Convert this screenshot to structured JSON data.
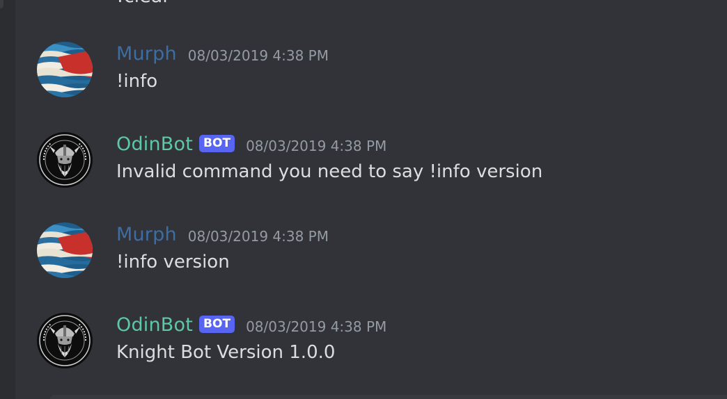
{
  "previous_message": {
    "text": "!clear"
  },
  "colors": {
    "background": "#313338",
    "murph_name": "#3c6ea5",
    "odinbot_name": "#5ec8a6",
    "bot_tag": "#5865f2",
    "timestamp": "#949ba4",
    "text": "#dbdee1"
  },
  "messages": [
    {
      "author": "Murph",
      "is_bot": false,
      "avatar_icon": "wave-flag-avatar-icon",
      "timestamp": "08/03/2019 4:38 PM",
      "content": "!info"
    },
    {
      "author": "OdinBot",
      "is_bot": true,
      "bot_label": "BOT",
      "avatar_icon": "viking-emblem-avatar-icon",
      "timestamp": "08/03/2019 4:38 PM",
      "content": "Invalid command you need to say !info version"
    },
    {
      "author": "Murph",
      "is_bot": false,
      "avatar_icon": "wave-flag-avatar-icon",
      "timestamp": "08/03/2019 4:38 PM",
      "content": "!info version"
    },
    {
      "author": "OdinBot",
      "is_bot": true,
      "bot_label": "BOT",
      "avatar_icon": "viking-emblem-avatar-icon",
      "timestamp": "08/03/2019 4:38 PM",
      "content": "Knight Bot Version 1.0.0"
    }
  ]
}
